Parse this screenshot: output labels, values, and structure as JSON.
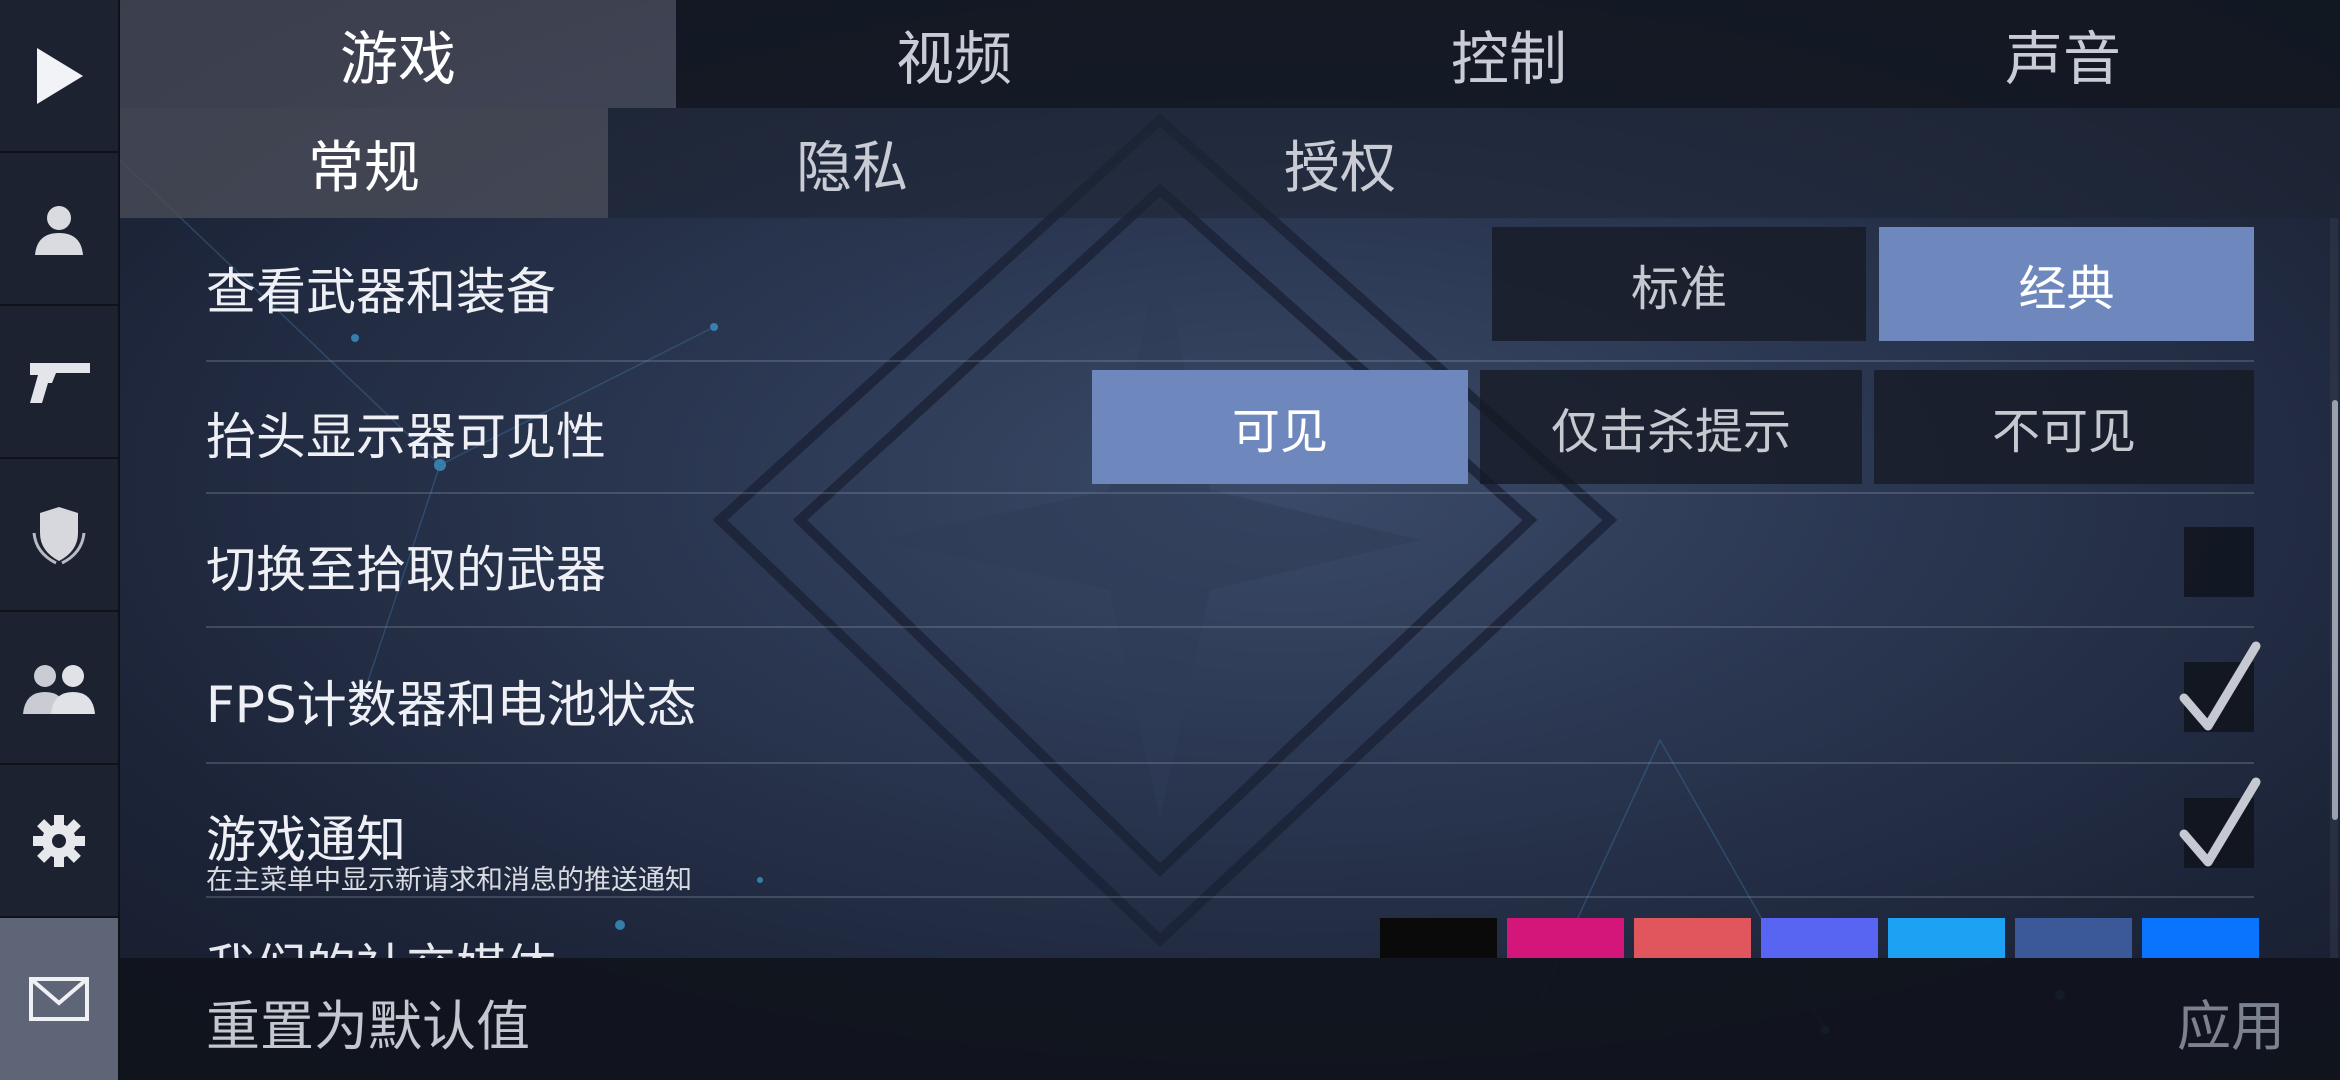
{
  "sidebar": {
    "items": [
      {
        "icon": "play-icon"
      },
      {
        "icon": "profile-icon"
      },
      {
        "icon": "pistol-icon"
      },
      {
        "icon": "clan-shield-icon"
      },
      {
        "icon": "friends-icon"
      },
      {
        "icon": "gear-icon"
      },
      {
        "icon": "mail-icon"
      }
    ],
    "active_index": 6
  },
  "tabs": [
    {
      "label": "游戏"
    },
    {
      "label": "视频"
    },
    {
      "label": "控制"
    },
    {
      "label": "声音"
    }
  ],
  "subtabs": [
    {
      "label": "常规"
    },
    {
      "label": "隐私"
    },
    {
      "label": "授权"
    }
  ],
  "settings": {
    "weapons_view": {
      "label": "查看武器和装备",
      "options": [
        "标准",
        "经典"
      ],
      "selected": "经典"
    },
    "hud_visibility": {
      "label": "抬头显示器可见性",
      "options": [
        "可见",
        "仅击杀提示",
        "不可见"
      ],
      "selected": "可见"
    },
    "switch_picked_weapon": {
      "label": "切换至拾取的武器",
      "checked": false
    },
    "fps_counter": {
      "label": "FPS计数器和电池状态",
      "checked": true
    },
    "game_notifications": {
      "label": "游戏通知",
      "description": "在主菜单中显示新请求和消息的推送通知",
      "checked": true
    },
    "social_media": {
      "label": "我们的社交媒体"
    }
  },
  "social_icons": [
    {
      "icon": "tiktok-icon",
      "color": "#0a0a0a"
    },
    {
      "icon": "instagram-icon",
      "color": "#d4157a"
    },
    {
      "icon": "youtube-icon",
      "color": "#e0565c"
    },
    {
      "icon": "discord-icon",
      "color": "#5865f2"
    },
    {
      "icon": "twitter-icon",
      "color": "#1da1f2"
    },
    {
      "icon": "facebook-icon",
      "color": "#3b5998"
    },
    {
      "icon": "vk-icon",
      "color": "#0a74ff"
    }
  ],
  "footer": {
    "reset_label": "重置为默认值",
    "apply_label": "应用"
  },
  "colors": {
    "accent": "#6e88be",
    "sidebar_bg": "#1d2230"
  }
}
